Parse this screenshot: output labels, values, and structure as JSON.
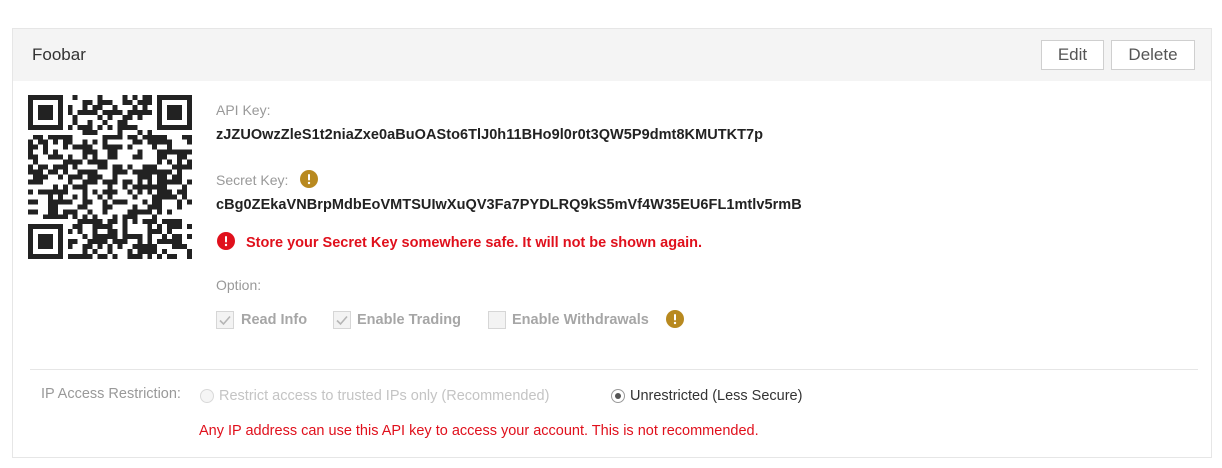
{
  "header": {
    "title": "Foobar",
    "edit_label": "Edit",
    "delete_label": "Delete"
  },
  "api_key": {
    "label": "API Key:",
    "value": "zJZUOwzZleS1t2niaZxe0aBuOASto6TlJ0h11BHo9l0r0t3QW5P9dmt8KMUTKT7p"
  },
  "secret_key": {
    "label": "Secret Key:",
    "value": "cBg0ZEkaVNBrpMdbEoVMTSUIwXuQV3Fa7PYDLRQ9kS5mVf4W35EU6FL1mtlv5rmB",
    "warning": "Store your Secret Key somewhere safe. It will not be shown again."
  },
  "options": {
    "label": "Option:",
    "items": [
      {
        "label": "Read Info",
        "checked": true
      },
      {
        "label": "Enable Trading",
        "checked": true
      },
      {
        "label": "Enable Withdrawals",
        "checked": false
      }
    ]
  },
  "ip_restriction": {
    "label": "IP Access Restriction:",
    "options": [
      {
        "label": "Restrict access to trusted IPs only (Recommended)",
        "selected": false
      },
      {
        "label": "Unrestricted (Less Secure)",
        "selected": true
      }
    ],
    "warning": "Any IP address can use this API key to access your account. This is not recommended."
  },
  "colors": {
    "error": "#e0101c",
    "info_icon": "#b8891f",
    "header_bg": "#f4f4f4"
  },
  "icons": {
    "qr": "qr-code-icon",
    "info": "exclamation-circle-icon",
    "error": "error-circle-icon",
    "check": "checkmark-icon"
  }
}
